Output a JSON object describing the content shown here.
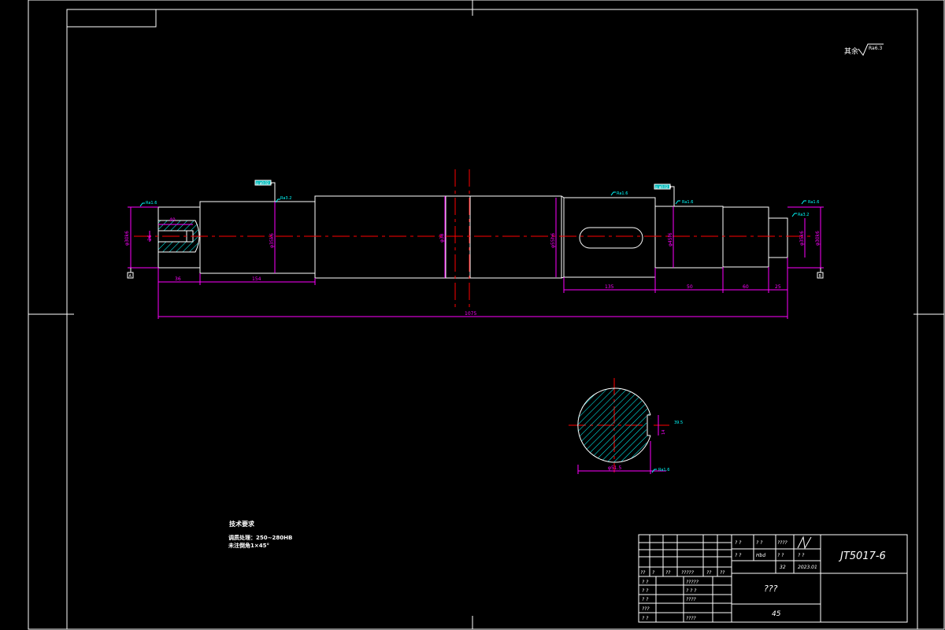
{
  "colors": {
    "background": "#000000",
    "outline": "#ffffff",
    "centerline": "#ff0000",
    "dimension": "#ff00ff",
    "annotation": "#00ffff",
    "hatch": "#00ffff"
  },
  "roughness_note": {
    "prefix": "其余",
    "value": "Ra6.3"
  },
  "dimensions": {
    "keyway_length": "40",
    "d_left_end": "φ30k6",
    "d_keyway_depth": "26",
    "d_shoulder": "φ35k6",
    "d_collar": "φ38",
    "d_main": "φ55h6",
    "d_keyseat": "φ45f6",
    "d_right_seat": "φ35k6",
    "d_right_end": "φ30k6",
    "len_left_end": "36",
    "len_left_journal": "154",
    "len_keyseat": "135",
    "len_right_journal": "50",
    "len_right_step": "60",
    "len_right_end": "25",
    "total_length": "1075",
    "section_dia": "φ51.5",
    "section_key_width": "14",
    "section_depth": "39.5"
  },
  "roughness_marks": [
    "Ra1.6",
    "Ra3.2",
    "Ra1.6",
    "Ra1.6",
    "Ra3.2",
    "Ra1.6",
    "Ra1.6"
  ],
  "datum_labels": [
    "A",
    "B"
  ],
  "tolerance_frames": [
    "◎ φ0.02 A",
    "◎ φ0.02 B"
  ],
  "tech_requirements": {
    "title": "技术要求",
    "line1": "调质处理：250~280HB",
    "line2": "未注倒角1×45°"
  },
  "title_block": {
    "drawing_number": "JT5017-6",
    "part_name": "???",
    "material": "45",
    "date": "2023.01",
    "scale": "1:2",
    "cells": {
      "r1a": "? ?",
      "r1b": "? ?",
      "r1c": "????",
      "r2a": "? ?",
      "r2b": "Hbd",
      "r2c": "? ?",
      "r2d": "? ?",
      "r3a": "32",
      "left_hdr": [
        "??",
        "?",
        "??",
        "?????",
        "??",
        "??"
      ],
      "left_rows": [
        [
          "? ?",
          "",
          "?????",
          ""
        ],
        [
          "? ?",
          "",
          "? ? ?",
          ""
        ],
        [
          "? ?",
          "",
          "????",
          ""
        ],
        [
          "???",
          "",
          "",
          ""
        ],
        [
          "? ?",
          "",
          "????",
          ""
        ]
      ]
    }
  }
}
